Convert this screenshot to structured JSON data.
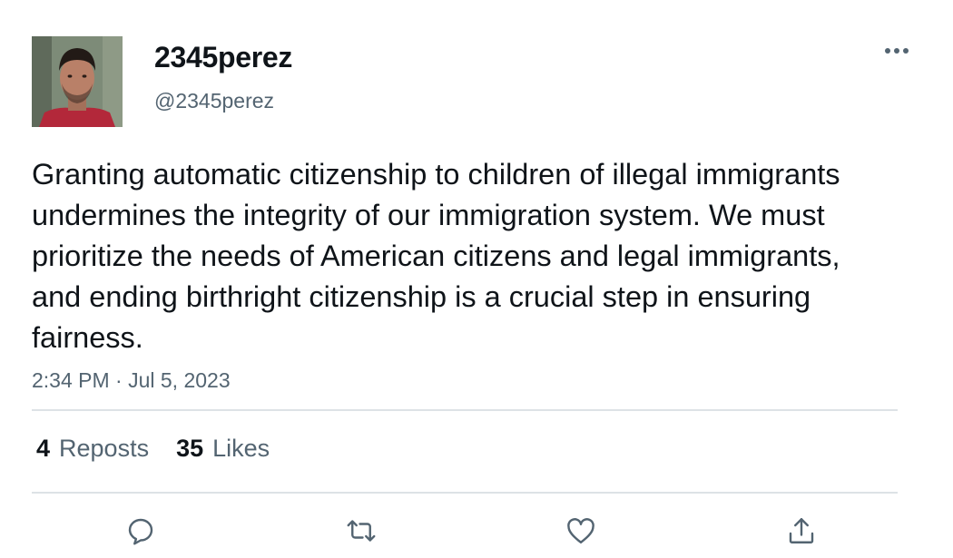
{
  "author": {
    "display_name": "2345perez",
    "handle": "@2345perez",
    "avatar_icon": "profile-photo-man"
  },
  "tweet": {
    "text": "Granting automatic citizenship to children of illegal immigrants undermines the integrity of our immigration system. We must prioritize the needs of American citizens and legal immigrants, and ending birthright citizenship is a crucial step in ensuring fairness.",
    "timestamp": "2:34 PM · Jul 5, 2023"
  },
  "stats": {
    "reposts_count": "4",
    "reposts_label": "Reposts",
    "likes_count": "35",
    "likes_label": "Likes"
  },
  "actions": [
    "reply-icon",
    "repost-icon",
    "like-icon",
    "share-icon"
  ],
  "colors": {
    "text_primary": "#0f1419",
    "text_secondary": "#536471",
    "divider": "#dde2e6"
  }
}
